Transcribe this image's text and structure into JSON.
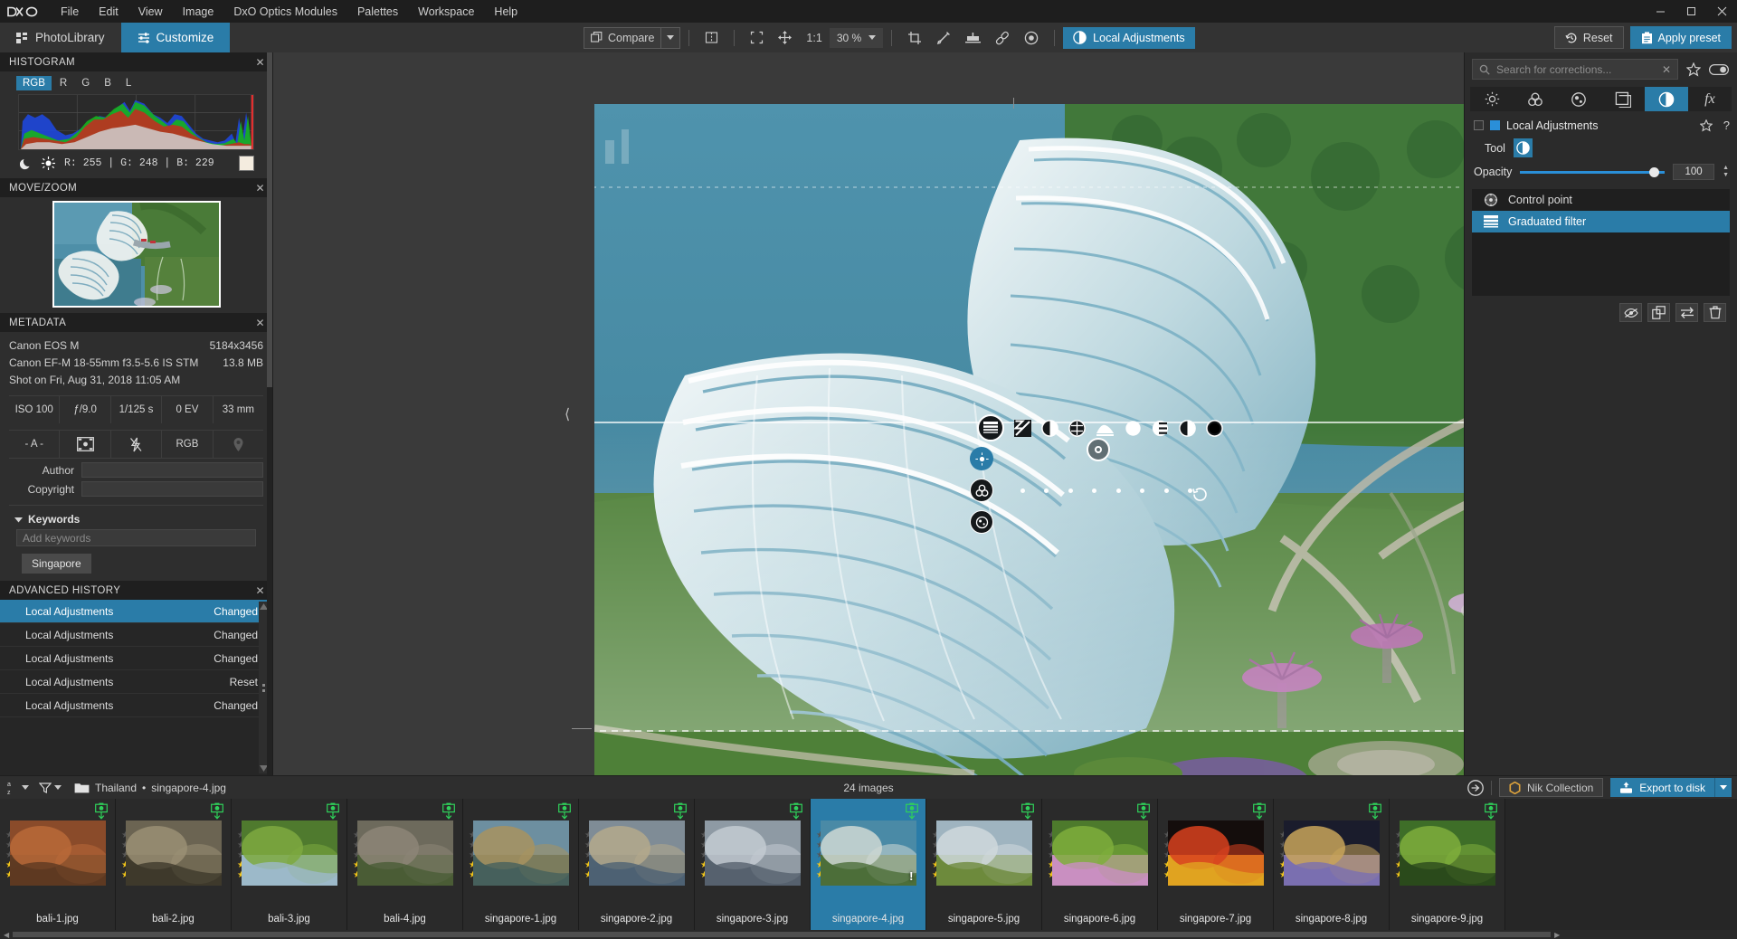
{
  "window": {
    "minimize": "─",
    "maximize": "☐",
    "close": "✕"
  },
  "menubar": {
    "logo": "D✕O",
    "items": [
      "File",
      "Edit",
      "View",
      "Image",
      "DxO Optics Modules",
      "Palettes",
      "Workspace",
      "Help"
    ]
  },
  "tabs": [
    {
      "label": "PhotoLibrary",
      "icon": "grid-icon",
      "active": false
    },
    {
      "label": "Customize",
      "icon": "sliders-icon",
      "active": true
    }
  ],
  "toolbar": {
    "compare_label": "Compare",
    "split_view_icon": "split-view-icon",
    "fit_icon": "fit-to-screen-icon",
    "pan_icon": "move-hand-icon",
    "one_to_one": "1:1",
    "zoom_value": "30 %",
    "crop_icon": "crop-icon",
    "eyedropper_icon": "eyedropper-icon",
    "horizon_icon": "horizon-level-icon",
    "repair_icon": "repair-eraser-icon",
    "preview_icon": "preview-eye-icon",
    "local_adjustments_label": "Local Adjustments",
    "reset_label": "Reset",
    "apply_preset_label": "Apply preset"
  },
  "histogram": {
    "title": "HISTOGRAM",
    "channels": [
      "RGB",
      "R",
      "G",
      "B",
      "L"
    ],
    "active_channel": "RGB",
    "shadow_icon": "moon-icon",
    "highlight_icon": "sun-icon",
    "readout": "R: 255  |  G: 248  |  B: 229",
    "swatch_color": "#f4ecdf"
  },
  "movezoom": {
    "title": "MOVE/ZOOM"
  },
  "metadata": {
    "title": "METADATA",
    "camera": "Canon EOS M",
    "dimensions": "5184x3456",
    "lens": "Canon EF-M 18-55mm f3.5-5.6 IS STM",
    "filesize": "13.8 MB",
    "shot_on": "Shot on Fri, Aug 31, 2018 11:05 AM",
    "row1": [
      "ISO 100",
      "ƒ/9.0",
      "1/125 s",
      "0 EV",
      "33 mm"
    ],
    "row2_meter": "- A -",
    "row2_focus_icon": "focus-area-icon",
    "row2_flash_icon": "flash-off-icon",
    "row2_colorspace": "RGB",
    "row2_gps_icon": "gps-pin-icon",
    "author_label": "Author",
    "author_value": "",
    "copyright_label": "Copyright",
    "copyright_value": "",
    "keywords_label": "Keywords",
    "keywords_placeholder": "Add keywords",
    "keyword_tags": [
      "Singapore"
    ]
  },
  "advanced_history": {
    "title": "ADVANCED HISTORY",
    "rows": [
      {
        "name": "Local Adjustments",
        "state": "Changed",
        "selected": true
      },
      {
        "name": "Local Adjustments",
        "state": "Changed",
        "selected": false
      },
      {
        "name": "Local Adjustments",
        "state": "Changed",
        "selected": false
      },
      {
        "name": "Local Adjustments",
        "state": "Reset",
        "selected": false
      },
      {
        "name": "Local Adjustments",
        "state": "Changed",
        "selected": false
      }
    ]
  },
  "right_panel": {
    "search_placeholder": "Search for corrections...",
    "clear_icon": "clear-search-icon",
    "favorite_icon": "star-icon",
    "toggle_icon": "toggle-switch-icon",
    "tabs": [
      {
        "name": "light-tab",
        "icon": "sun-icon",
        "active": false
      },
      {
        "name": "color-tab",
        "icon": "color-circles-icon",
        "active": false
      },
      {
        "name": "detail-tab",
        "icon": "detail-icon",
        "active": false
      },
      {
        "name": "geometry-tab",
        "icon": "cube-icon",
        "active": false
      },
      {
        "name": "local-adjustments-tab",
        "icon": "local-adjust-icon",
        "active": true
      },
      {
        "name": "effects-tab",
        "icon": "fx-icon",
        "active": false
      }
    ],
    "section_title": "Local Adjustments",
    "help_icon": "?",
    "tool_label": "Tool",
    "tool_icon": "graduated-filter-icon",
    "opacity_label": "Opacity",
    "opacity_value": "100",
    "masks": [
      {
        "label": "Control point",
        "icon": "control-point-icon",
        "selected": false
      },
      {
        "label": "Graduated filter",
        "icon": "graduated-filter-icon",
        "selected": true
      }
    ],
    "mask_buttons": [
      {
        "name": "show-mask-button",
        "icon": "eye-slash-icon"
      },
      {
        "name": "duplicate-mask-button",
        "icon": "duplicate-icon"
      },
      {
        "name": "invert-mask-button",
        "icon": "swap-arrows-icon"
      },
      {
        "name": "delete-mask-button",
        "icon": "trash-icon"
      }
    ]
  },
  "overlay": {
    "tools": [
      "exposure-compensation-icon",
      "contrast-icon",
      "microcontrast-icon",
      "selective-tone-icon",
      "vibrancy-icon",
      "saturation-icon",
      "hue-icon",
      "blur-icon"
    ],
    "left_handles": [
      "graduated-filter-handle",
      "light-handle",
      "color-handle",
      "detail-handle"
    ],
    "reset_icon": "reset-mask-icon"
  },
  "statusbar": {
    "sort_icon": "sort-az-icon",
    "filter_icon": "filter-funnel-icon",
    "folder_icon": "folder-icon",
    "folder_name": "Thailand",
    "separator": "•",
    "file_name": "singapore-4.jpg",
    "image_count": "24 images",
    "goto_icon": "go-to-icon",
    "nik_label": "Nik Collection",
    "export_label": "Export to disk"
  },
  "filmstrip": {
    "items": [
      {
        "name": "bali-1.jpg",
        "stars": 2,
        "selected": false,
        "processed": true,
        "warning": false,
        "colors": [
          "#8a4b2a",
          "#b96a38",
          "#5e3a22"
        ]
      },
      {
        "name": "bali-2.jpg",
        "stars": 2,
        "selected": false,
        "processed": true,
        "warning": false,
        "colors": [
          "#6b6452",
          "#9a8f74",
          "#3f3a2c"
        ]
      },
      {
        "name": "bali-3.jpg",
        "stars": 2,
        "selected": false,
        "processed": true,
        "warning": false,
        "colors": [
          "#4f7a2e",
          "#7ea93f",
          "#9cb9c9"
        ]
      },
      {
        "name": "bali-4.jpg",
        "stars": 2,
        "selected": false,
        "processed": true,
        "warning": false,
        "colors": [
          "#6d6a5c",
          "#8d8577",
          "#4a5c36"
        ]
      },
      {
        "name": "singapore-1.jpg",
        "stars": 2,
        "selected": false,
        "processed": true,
        "warning": false,
        "colors": [
          "#6d8fa0",
          "#a8935f",
          "#46605c"
        ]
      },
      {
        "name": "singapore-2.jpg",
        "stars": 2,
        "selected": false,
        "processed": true,
        "warning": false,
        "colors": [
          "#7f8c96",
          "#b4a98c",
          "#4e6273"
        ]
      },
      {
        "name": "singapore-3.jpg",
        "stars": 2,
        "selected": false,
        "processed": true,
        "warning": false,
        "colors": [
          "#8e9aa4",
          "#c3cbd2",
          "#56626e"
        ]
      },
      {
        "name": "singapore-4.jpg",
        "stars": 2,
        "selected": true,
        "processed": true,
        "warning": true,
        "colors": [
          "#4a8aa6",
          "#cfd8d4",
          "#4c6e3a"
        ]
      },
      {
        "name": "singapore-5.jpg",
        "stars": 2,
        "selected": false,
        "processed": true,
        "warning": false,
        "colors": [
          "#9fb4c0",
          "#cfd8dc",
          "#6d8a3c"
        ]
      },
      {
        "name": "singapore-6.jpg",
        "stars": 2,
        "selected": false,
        "processed": true,
        "warning": false,
        "colors": [
          "#4d7a2c",
          "#7fae3c",
          "#c98fc0"
        ]
      },
      {
        "name": "singapore-7.jpg",
        "stars": 2,
        "selected": false,
        "processed": true,
        "warning": false,
        "colors": [
          "#140d0c",
          "#d8421f",
          "#e0a321"
        ]
      },
      {
        "name": "singapore-8.jpg",
        "stars": 2,
        "selected": false,
        "processed": true,
        "warning": false,
        "colors": [
          "#1a1c2c",
          "#c9a45a",
          "#7b6fb0"
        ]
      },
      {
        "name": "singapore-9.jpg",
        "stars": 2,
        "selected": false,
        "processed": true,
        "warning": false,
        "colors": [
          "#3e6e28",
          "#7fae3c",
          "#2b4a1c"
        ]
      }
    ]
  },
  "colors": {
    "accent": "#2a7ca8",
    "panel": "#2b2b2b",
    "panel_dark": "#1f1f1f",
    "star": "#f0c419",
    "processed": "#2fd15a"
  }
}
